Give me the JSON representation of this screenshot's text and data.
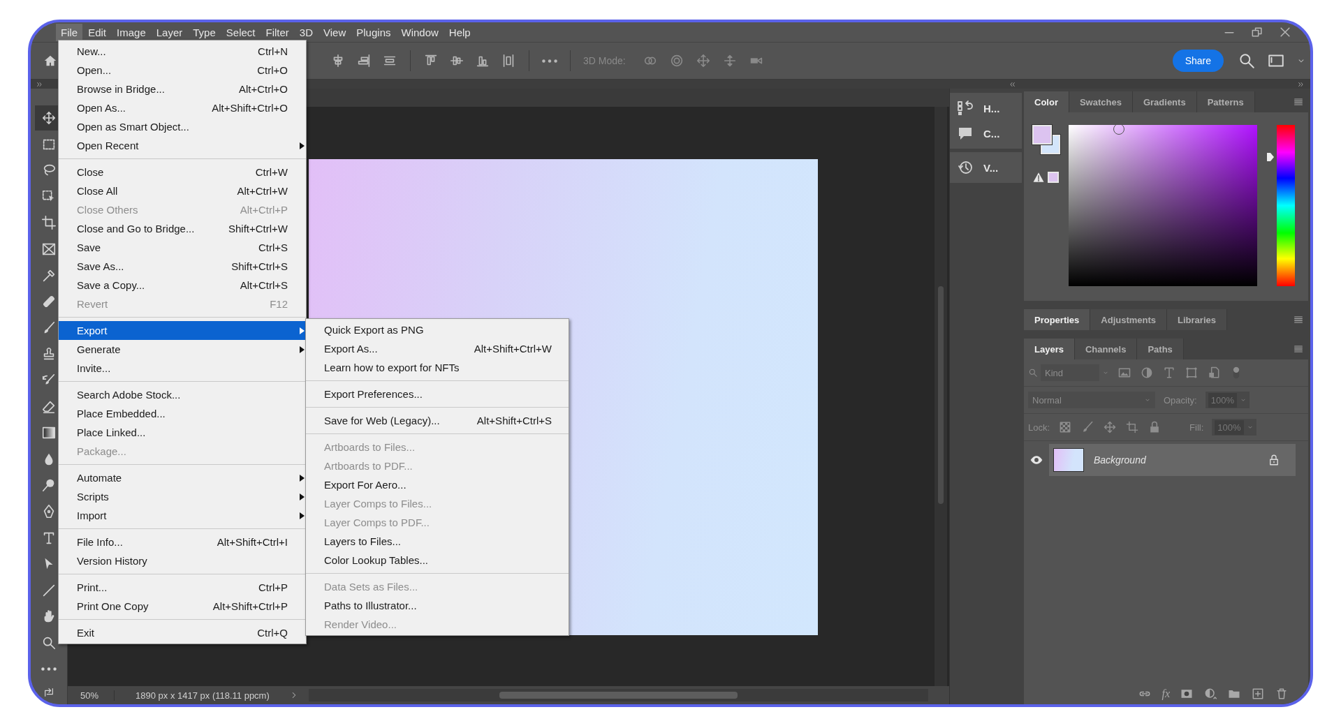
{
  "menu_bar": [
    {
      "label": "File",
      "selected": true
    },
    {
      "label": "Edit",
      "selected": false
    },
    {
      "label": "Image",
      "selected": false
    },
    {
      "label": "Layer",
      "selected": false
    },
    {
      "label": "Type",
      "selected": false
    },
    {
      "label": "Select",
      "selected": false
    },
    {
      "label": "Filter",
      "selected": false
    },
    {
      "label": "3D",
      "selected": false
    },
    {
      "label": "View",
      "selected": false
    },
    {
      "label": "Plugins",
      "selected": false
    },
    {
      "label": "Window",
      "selected": false
    },
    {
      "label": "Help",
      "selected": false
    }
  ],
  "options_bar": {
    "mode_label": "3D Mode:",
    "share_button": "Share"
  },
  "tools": [
    {
      "kind": "move",
      "selected": true
    },
    {
      "kind": "marquee",
      "selected": false
    },
    {
      "kind": "lasso",
      "selected": false
    },
    {
      "kind": "object",
      "selected": false
    },
    {
      "kind": "crop",
      "selected": false
    },
    {
      "kind": "frame",
      "selected": false
    },
    {
      "kind": "eyedropper",
      "selected": false
    },
    {
      "kind": "bandage",
      "selected": false
    },
    {
      "kind": "brush",
      "selected": false
    },
    {
      "kind": "stamp",
      "selected": false
    },
    {
      "kind": "history",
      "selected": false
    },
    {
      "kind": "eraser",
      "selected": false
    },
    {
      "kind": "gradient",
      "selected": false
    },
    {
      "kind": "drop",
      "selected": false
    },
    {
      "kind": "dodge",
      "selected": false
    },
    {
      "kind": "pen",
      "selected": false
    },
    {
      "kind": "type",
      "selected": false
    },
    {
      "kind": "pointer",
      "selected": false
    },
    {
      "kind": "line",
      "selected": false
    },
    {
      "kind": "hand",
      "selected": false
    },
    {
      "kind": "zoom",
      "selected": false
    },
    {
      "kind": "more",
      "selected": false
    }
  ],
  "file_menu": {
    "groups": [
      {
        "items": [
          {
            "label": "New...",
            "shortcut": "Ctrl+N",
            "disabled": false,
            "submenu": false,
            "selected": false
          },
          {
            "label": "Open...",
            "shortcut": "Ctrl+O",
            "disabled": false,
            "submenu": false,
            "selected": false
          },
          {
            "label": "Browse in Bridge...",
            "shortcut": "Alt+Ctrl+O",
            "disabled": false,
            "submenu": false,
            "selected": false
          },
          {
            "label": "Open As...",
            "shortcut": "Alt+Shift+Ctrl+O",
            "disabled": false,
            "submenu": false,
            "selected": false
          },
          {
            "label": "Open as Smart Object...",
            "disabled": false,
            "submenu": false,
            "selected": false
          },
          {
            "label": "Open Recent",
            "disabled": false,
            "submenu": true,
            "selected": false
          }
        ]
      },
      {
        "items": [
          {
            "label": "Close",
            "shortcut": "Ctrl+W",
            "disabled": false,
            "submenu": false,
            "selected": false
          },
          {
            "label": "Close All",
            "shortcut": "Alt+Ctrl+W",
            "disabled": false,
            "submenu": false,
            "selected": false
          },
          {
            "label": "Close Others",
            "shortcut": "Alt+Ctrl+P",
            "disabled": true,
            "submenu": false,
            "selected": false
          },
          {
            "label": "Close and Go to Bridge...",
            "shortcut": "Shift+Ctrl+W",
            "disabled": false,
            "submenu": false,
            "selected": false
          },
          {
            "label": "Save",
            "shortcut": "Ctrl+S",
            "disabled": false,
            "submenu": false,
            "selected": false
          },
          {
            "label": "Save As...",
            "shortcut": "Shift+Ctrl+S",
            "disabled": false,
            "submenu": false,
            "selected": false
          },
          {
            "label": "Save a Copy...",
            "shortcut": "Alt+Ctrl+S",
            "disabled": false,
            "submenu": false,
            "selected": false
          },
          {
            "label": "Revert",
            "shortcut": "F12",
            "disabled": true,
            "submenu": false,
            "selected": false
          }
        ]
      },
      {
        "items": [
          {
            "label": "Export",
            "disabled": false,
            "submenu": true,
            "selected": true
          },
          {
            "label": "Generate",
            "disabled": false,
            "submenu": true,
            "selected": false
          },
          {
            "label": "Invite...",
            "disabled": false,
            "submenu": false,
            "selected": false
          }
        ]
      },
      {
        "items": [
          {
            "label": "Search Adobe Stock...",
            "disabled": false,
            "submenu": false,
            "selected": false
          },
          {
            "label": "Place Embedded...",
            "disabled": false,
            "submenu": false,
            "selected": false
          },
          {
            "label": "Place Linked...",
            "disabled": false,
            "submenu": false,
            "selected": false
          },
          {
            "label": "Package...",
            "disabled": true,
            "submenu": false,
            "selected": false
          }
        ]
      },
      {
        "items": [
          {
            "label": "Automate",
            "disabled": false,
            "submenu": true,
            "selected": false
          },
          {
            "label": "Scripts",
            "disabled": false,
            "submenu": true,
            "selected": false
          },
          {
            "label": "Import",
            "disabled": false,
            "submenu": true,
            "selected": false
          }
        ]
      },
      {
        "items": [
          {
            "label": "File Info...",
            "shortcut": "Alt+Shift+Ctrl+I",
            "disabled": false,
            "submenu": false,
            "selected": false
          },
          {
            "label": "Version History",
            "disabled": false,
            "submenu": false,
            "selected": false
          }
        ]
      },
      {
        "items": [
          {
            "label": "Print...",
            "shortcut": "Ctrl+P",
            "disabled": false,
            "submenu": false,
            "selected": false
          },
          {
            "label": "Print One Copy",
            "shortcut": "Alt+Shift+Ctrl+P",
            "disabled": false,
            "submenu": false,
            "selected": false
          }
        ]
      },
      {
        "items": [
          {
            "label": "Exit",
            "shortcut": "Ctrl+Q",
            "disabled": false,
            "submenu": false,
            "selected": false
          }
        ]
      }
    ]
  },
  "export_menu": {
    "groups": [
      {
        "items": [
          {
            "label": "Quick Export as PNG",
            "disabled": false
          },
          {
            "label": "Export As...",
            "shortcut": "Alt+Shift+Ctrl+W",
            "disabled": false
          },
          {
            "label": "Learn how to export for NFTs",
            "disabled": false
          }
        ]
      },
      {
        "items": [
          {
            "label": "Export Preferences...",
            "disabled": false
          }
        ]
      },
      {
        "items": [
          {
            "label": "Save for Web (Legacy)...",
            "shortcut": "Alt+Shift+Ctrl+S",
            "disabled": false
          }
        ]
      },
      {
        "items": [
          {
            "label": "Artboards to Files...",
            "disabled": true
          },
          {
            "label": "Artboards to PDF...",
            "disabled": true
          },
          {
            "label": "Export For Aero...",
            "disabled": false
          },
          {
            "label": "Layer Comps to Files...",
            "disabled": true
          },
          {
            "label": "Layer Comps to PDF...",
            "disabled": true
          },
          {
            "label": "Layers to Files...",
            "disabled": false
          },
          {
            "label": "Color Lookup Tables...",
            "disabled": false
          }
        ]
      },
      {
        "items": [
          {
            "label": "Data Sets as Files...",
            "disabled": true
          },
          {
            "label": "Paths to Illustrator...",
            "disabled": false
          },
          {
            "label": "Render Video...",
            "disabled": true
          }
        ]
      }
    ]
  },
  "dock": {
    "groups": [
      {
        "items": [
          {
            "kind": "history",
            "label": "H..."
          },
          {
            "kind": "comments",
            "label": "C..."
          }
        ]
      },
      {
        "items": [
          {
            "kind": "versions",
            "label": "V..."
          }
        ]
      }
    ]
  },
  "color_panel": {
    "tabs": [
      {
        "label": "Color",
        "selected": true
      },
      {
        "label": "Swatches",
        "selected": false
      },
      {
        "label": "Gradients",
        "selected": false
      },
      {
        "label": "Patterns",
        "selected": false
      }
    ],
    "hue_slider": {
      "level": 0.8
    }
  },
  "properties_panel": {
    "tabs": [
      {
        "label": "Properties",
        "selected": true
      },
      {
        "label": "Adjustments",
        "selected": false
      },
      {
        "label": "Libraries",
        "selected": false
      }
    ]
  },
  "layers_panel": {
    "tabs": [
      {
        "label": "Layers",
        "selected": true
      },
      {
        "label": "Channels",
        "selected": false
      },
      {
        "label": "Paths",
        "selected": false
      }
    ],
    "filter": {
      "placeholder": "Kind"
    },
    "blend_mode": "Normal",
    "opacity_label": "Opacity:",
    "opacity": "100%",
    "lock_label": "Lock:",
    "fill_label": "Fill:",
    "fill": "100%",
    "layers": [
      {
        "name": "Background",
        "visible": true,
        "selected": true,
        "locked": true
      }
    ],
    "effects_label": "fx"
  },
  "status_bar": {
    "zoom": "50%",
    "document_info": "1890 px x 1417 px (118.11 ppcm)"
  }
}
